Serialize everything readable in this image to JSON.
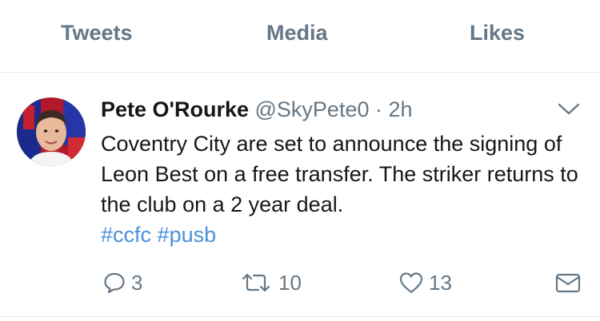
{
  "tabs": [
    {
      "label": "Tweets"
    },
    {
      "label": "Media"
    },
    {
      "label": "Likes"
    }
  ],
  "tweet": {
    "author_name": "Pete O'Rourke",
    "handle": "@SkyPete0",
    "separator": "·",
    "time": "2h",
    "text": "Coventry City are set to announce the signing of Leon Best on a free transfer. The striker returns to the club on a 2 year deal.",
    "hashtags": [
      "#ccfc",
      "#pusb"
    ],
    "reply_count": "3",
    "retweet_count": "10",
    "like_count": "13"
  },
  "icons": {
    "reply": "reply-icon",
    "retweet": "retweet-icon",
    "like": "heart-icon",
    "message": "envelope-icon",
    "menu": "chevron-down-icon"
  },
  "colors": {
    "text": "#14171a",
    "secondary": "#657786",
    "hashtag": "#4a90d9",
    "divider": "#e6ecf0"
  }
}
